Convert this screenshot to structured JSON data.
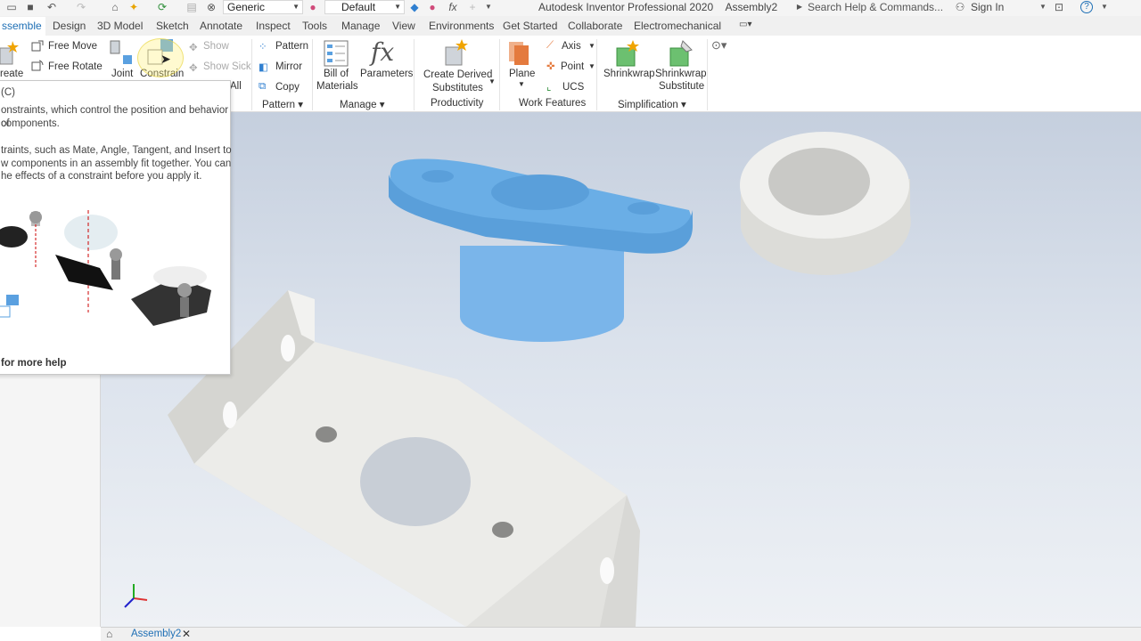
{
  "quick_access": {
    "appearance_combo": "Generic",
    "style_combo": "Default",
    "app_title": "Autodesk Inventor Professional 2020",
    "document_title": "Assembly2",
    "search_placeholder": "Search Help & Commands...",
    "signin_label": "Sign In"
  },
  "tabs": [
    "ssemble",
    "Design",
    "3D Model",
    "Sketch",
    "Annotate",
    "Inspect",
    "Tools",
    "Manage",
    "View",
    "Environments",
    "Get Started",
    "Collaborate",
    "Electromechanical"
  ],
  "ribbon": {
    "create_label": "reate",
    "free_move": "Free Move",
    "free_rotate": "Free Rotate",
    "joint": "Joint",
    "constrain": "Constrain",
    "show": "Show",
    "show_sick": "Show Sick",
    "all_label": "All",
    "pattern": "Pattern",
    "mirror": "Mirror",
    "copy": "Copy",
    "bom_line1": "Bill of",
    "bom_line2": "Materials",
    "parameters": "Parameters",
    "derived_line1": "Create Derived",
    "derived_line2": "Substitutes",
    "plane": "Plane",
    "axis": "Axis",
    "point": "Point",
    "ucs": "UCS",
    "shrinkwrap": "Shrinkwrap",
    "shrink_sub_line1": "Shrinkwrap",
    "shrink_sub_line2": "Substitute",
    "panels": {
      "pattern": "Pattern",
      "manage": "Manage",
      "productivity": "Productivity",
      "work_features": "Work Features",
      "simplification": "Simplification"
    }
  },
  "tooltip": {
    "shortcut": "(C)",
    "para1_line1": "onstraints, which control the position and behavior of",
    "para1_line2": "components.",
    "para2_line1": "traints, such as Mate, Angle, Tangent, and Insert to",
    "para2_line2": "w components in an assembly fit together. You can",
    "para2_line3": "he effects of a constraint before you apply it.",
    "footer": "for more help"
  },
  "status_bar": {
    "doc_tab": "Assembly2"
  },
  "colors": {
    "accent": "#1e6fb5",
    "selected_part": "#6aaee6",
    "part_gray": "#e6e6e3"
  }
}
